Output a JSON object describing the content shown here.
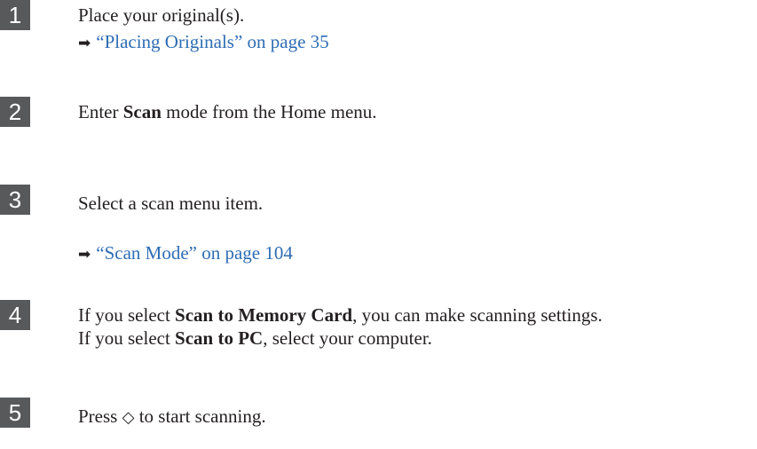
{
  "steps": [
    {
      "number": "1",
      "text": "Place your original(s).",
      "reference": {
        "arrow": "➡",
        "link": "“Placing Originals” on page 35"
      }
    },
    {
      "number": "2",
      "prefix": "Enter ",
      "bold": "Scan",
      "suffix": " mode from the Home menu."
    },
    {
      "number": "3",
      "text": "Select a scan menu item.",
      "reference": {
        "arrow": "➡",
        "link": "“Scan Mode” on page 104"
      }
    },
    {
      "number": "4",
      "line1": {
        "prefix": "If you select ",
        "bold": "Scan to Memory Card",
        "suffix": ", you can make scanning settings."
      },
      "line2": {
        "prefix": "If you select ",
        "bold": "Scan to PC",
        "suffix": ", select your computer."
      }
    },
    {
      "number": "5",
      "prefix": "Press ",
      "icon": "start-button-icon",
      "icon_glyph": "◇",
      "suffix": " to start scanning."
    }
  ]
}
